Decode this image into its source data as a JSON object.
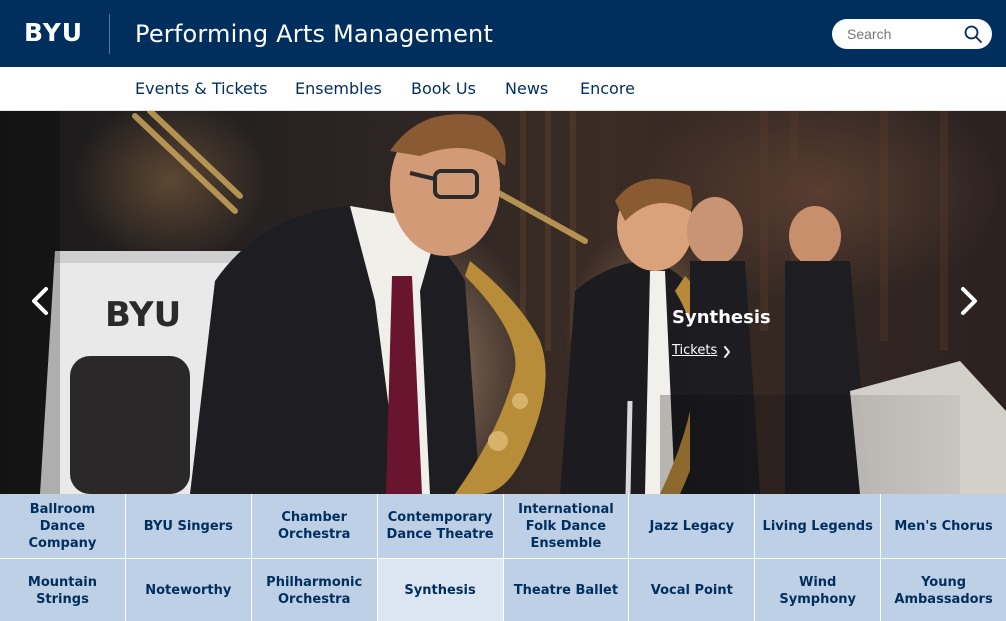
{
  "header": {
    "logo_text": "BYU",
    "site_title": "Performing Arts Management",
    "search": {
      "placeholder": "Search",
      "value": ""
    }
  },
  "nav": {
    "items": [
      {
        "label": "Events & Tickets"
      },
      {
        "label": "Ensembles"
      },
      {
        "label": "Book Us"
      },
      {
        "label": "News"
      },
      {
        "label": "Encore"
      }
    ]
  },
  "hero": {
    "image_text": "BYU",
    "caption_title": "Synthesis",
    "caption_link": "Tickets",
    "prev_icon": "chevron-left-icon",
    "next_icon": "chevron-right-icon"
  },
  "ensembles": [
    {
      "label": "Ballroom Dance Company"
    },
    {
      "label": "BYU Singers"
    },
    {
      "label": "Chamber Orchestra"
    },
    {
      "label": "Contemporary Dance Theatre"
    },
    {
      "label": "International Folk Dance Ensemble"
    },
    {
      "label": "Jazz Legacy"
    },
    {
      "label": "Living Legends"
    },
    {
      "label": "Men's Chorus"
    },
    {
      "label": "Mountain Strings"
    },
    {
      "label": "Noteworthy"
    },
    {
      "label": "Philharmonic Orchestra"
    },
    {
      "label": "Synthesis",
      "active": true
    },
    {
      "label": "Theatre Ballet"
    },
    {
      "label": "Vocal Point"
    },
    {
      "label": "Wind Symphony"
    },
    {
      "label": "Young Ambassadors"
    }
  ],
  "colors": {
    "brand_navy": "#002e5d",
    "tile_background": "#bdd0e6",
    "tile_active": "#dbe6f2"
  }
}
